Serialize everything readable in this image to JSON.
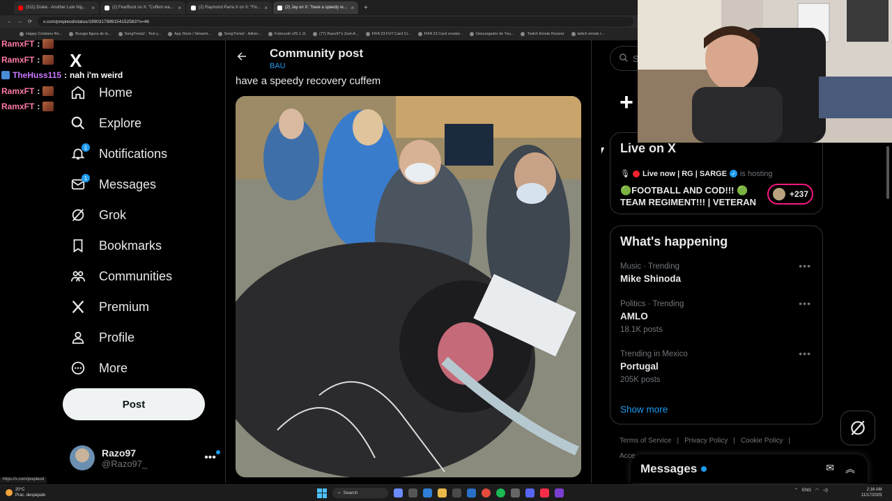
{
  "browser": {
    "tabs": [
      {
        "title": "(311) Drake - Another Late Nig...",
        "color": "#ff0000"
      },
      {
        "title": "(2) FearBuck on X: \"Cuffem wa...",
        "color": "#ffffff"
      },
      {
        "title": "(2) Raymond Parra X on X: \"Fin...",
        "color": "#ffffff"
      },
      {
        "title": "(2) Jay on X: \"have a speedy re...",
        "color": "#ffffff"
      }
    ],
    "url": "x.com/prepleod/status/1990317989154152583?s=46",
    "bookmarks": [
      "Happy Cristiano Ro...",
      "Burago figura de to...",
      "SongTrivia2 - Test y...",
      "App Store / Streami...",
      "SongTrivia2 - Adivin...",
      "Futecuob v25.1.11",
      "(77) Razo97's Zest-A...",
      "FIFA 23 FUT Card Cr...",
      "FIFA 23 Card creator...",
      "Descargador de You...",
      "Twitch Emote Resizer",
      "twitch emote r..."
    ],
    "status_link": "https://x.com/prepleod"
  },
  "chat": [
    {
      "user": "RamxFT",
      "sep": ":",
      "emote": true,
      "msg": ""
    },
    {
      "user": "RamxFT",
      "sep": ":",
      "emote": true,
      "msg": ""
    },
    {
      "user": "TheHuss115",
      "sep": ":",
      "emote": false,
      "msg": "nah i'm weird"
    },
    {
      "user": "RamxFT",
      "sep": ":",
      "emote": true,
      "msg": ""
    },
    {
      "user": "RamxFT",
      "sep": ":",
      "emote": true,
      "msg": ""
    }
  ],
  "nav": {
    "logo": "X",
    "items": [
      {
        "label": "Home",
        "icon": "home-icon",
        "badge": ""
      },
      {
        "label": "Explore",
        "icon": "search-icon",
        "badge": ""
      },
      {
        "label": "Notifications",
        "icon": "bell-icon",
        "badge": "1"
      },
      {
        "label": "Messages",
        "icon": "mail-icon",
        "badge": "1"
      },
      {
        "label": "Grok",
        "icon": "grok-icon",
        "badge": ""
      },
      {
        "label": "Bookmarks",
        "icon": "bookmark-icon",
        "badge": ""
      },
      {
        "label": "Communities",
        "icon": "people-icon",
        "badge": ""
      },
      {
        "label": "Premium",
        "icon": "x-logo-icon",
        "badge": ""
      },
      {
        "label": "Profile",
        "icon": "person-icon",
        "badge": ""
      },
      {
        "label": "More",
        "icon": "more-circle-icon",
        "badge": ""
      }
    ],
    "post_button": "Post",
    "account": {
      "name": "Razo97",
      "handle": "@Razo97_"
    }
  },
  "post": {
    "header_title": "Community post",
    "header_subtitle": "BAU",
    "text": "have a speedy recovery cuffem"
  },
  "sidebar": {
    "search_placeholder": "Se",
    "live": {
      "title": "Live on X",
      "host_line": "Live now | RG | SARGE",
      "hosting": "is hosting",
      "stream_title": "🟢FOOTBALL AND COD!!! 🟢 TEAM REGIMENT!!! | VETERAN",
      "listeners": "+237"
    },
    "happening": {
      "title": "What's happening",
      "trends": [
        {
          "category": "Music · Trending",
          "name": "Mike Shinoda",
          "count": ""
        },
        {
          "category": "Politics · Trending",
          "name": "AMLO",
          "count": "18.1K posts"
        },
        {
          "category": "Trending in Mexico",
          "name": "Portugal",
          "count": "205K posts"
        }
      ],
      "show_more": "Show more"
    },
    "footer": [
      "Terms of Service",
      "Privacy Policy",
      "Cookie Policy"
    ],
    "footer_more": "Acce"
  },
  "messages_drawer": {
    "title": "Messages"
  },
  "taskbar": {
    "weather_temp": "20°C",
    "weather_desc": "Prac. despejado",
    "search": "Search",
    "lang": "ENG",
    "time": "2:16 AM",
    "date": "11/17/2025"
  }
}
